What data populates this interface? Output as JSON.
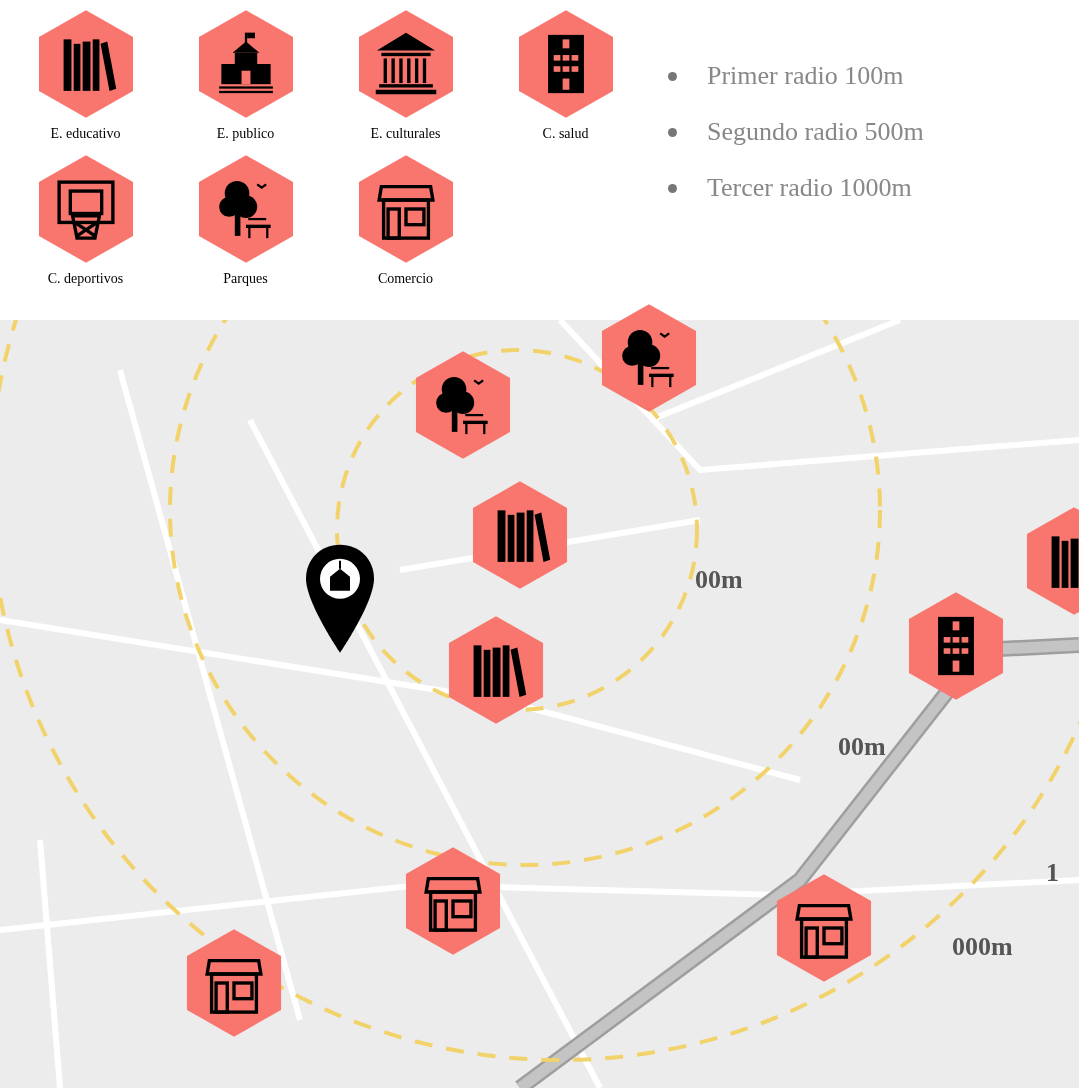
{
  "legend": [
    {
      "kind": "books",
      "label": "E. educativo"
    },
    {
      "kind": "school",
      "label": "E. publico"
    },
    {
      "kind": "museum",
      "label": "E. culturales"
    },
    {
      "kind": "hospital",
      "label": "C. salud"
    },
    {
      "kind": "basket",
      "label": "C. deportivos"
    },
    {
      "kind": "park",
      "label": "Parques"
    },
    {
      "kind": "shop",
      "label": "Comercio"
    }
  ],
  "radii": [
    "Primer radio 100m",
    "Segundo radio 500m",
    "Tercer radio 1000m"
  ],
  "map": {
    "markers": [
      {
        "kind": "park"
      },
      {
        "kind": "park"
      },
      {
        "kind": "books"
      },
      {
        "kind": "books"
      },
      {
        "kind": "hospital"
      },
      {
        "kind": "books"
      },
      {
        "kind": "shop"
      },
      {
        "kind": "shop"
      },
      {
        "kind": "shop"
      },
      {
        "kind": "pin"
      }
    ],
    "radius_labels": [
      "00m",
      "00m",
      "1",
      "000m"
    ]
  }
}
